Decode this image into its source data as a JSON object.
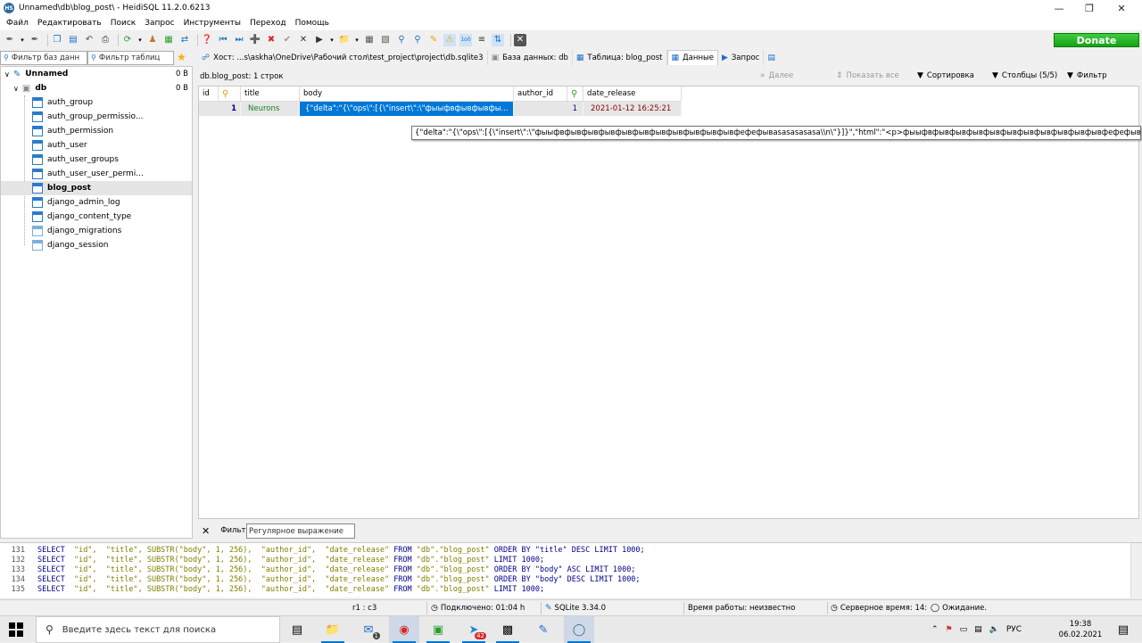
{
  "window": {
    "title": "Unnamed\\db\\blog_post\\ - HeidiSQL 11.2.0.6213",
    "app_icon": "HS"
  },
  "menu": [
    "Файл",
    "Редактировать",
    "Поиск",
    "Запрос",
    "Инструменты",
    "Переход",
    "Помощь"
  ],
  "toolbar": {
    "donate_label": "Donate"
  },
  "filters": {
    "db_filter_placeholder": "Фильтр баз данн",
    "table_filter_placeholder": "Фильтр таблиц"
  },
  "tabs": [
    {
      "label": "Хост: ...s\\askha\\OneDrive\\Рабочий стол\\test_project\\project\\db.sqlite3",
      "icon": "host-icon"
    },
    {
      "label": "База данных: db",
      "icon": "database-icon"
    },
    {
      "label": "Таблица: blog_post",
      "icon": "table-icon"
    },
    {
      "label": "Данные",
      "icon": "grid-icon",
      "active": true
    },
    {
      "label": "Запрос",
      "icon": "play-icon"
    }
  ],
  "tree": {
    "root": {
      "label": "Unnamed",
      "size": "0 B"
    },
    "db": {
      "label": "db",
      "size": "0 B"
    },
    "tables": [
      {
        "label": "auth_group"
      },
      {
        "label": "auth_group_permissio..."
      },
      {
        "label": "auth_permission"
      },
      {
        "label": "auth_user"
      },
      {
        "label": "auth_user_groups"
      },
      {
        "label": "auth_user_user_permi..."
      },
      {
        "label": "blog_post",
        "selected": true
      },
      {
        "label": "django_admin_log"
      },
      {
        "label": "django_content_type"
      },
      {
        "label": "django_migrations"
      },
      {
        "label": "django_session"
      }
    ]
  },
  "data_panel": {
    "caption": "db.blog_post: 1 строк",
    "next_label": "Далее",
    "show_all_label": "Показать все",
    "sort_label": "Сортировка",
    "columns_label": "Столбцы (5/5)",
    "filter_label": "Фильтр"
  },
  "grid": {
    "columns": [
      "id",
      "title",
      "body",
      "author_id",
      "date_release"
    ],
    "rows": [
      {
        "id": "1",
        "title": "Neurons",
        "body": "{\"delta\":\"{\\\"ops\\\":[{\\\"insert\\\":\\\"фыыфвфывфывфы...",
        "author_id": "1",
        "date_release": "2021-01-12 16:25:21"
      }
    ],
    "tooltip": "{\"delta\":\"{\\\"ops\\\":[{\\\"insert\\\":\\\"фыыфвфывфывфывфывфывфывфывфывфывфывфефефывasasasasasa\\\\n\\\"}]}\",\"html\":\"<p>фыыфвфывфывфывфывфывфывфывфывфывфывфефефывasasasasasa</p>\"}"
  },
  "filter_bar": {
    "label": "Фильт",
    "regex_placeholder": "Регулярное выражение"
  },
  "sql_log": [
    {
      "num": "131",
      "order": " ORDER BY \"title\" DESC LIMIT 1000;"
    },
    {
      "num": "132",
      "order": " LIMIT 1000;"
    },
    {
      "num": "133",
      "order": " ORDER BY \"body\" ASC LIMIT 1000;"
    },
    {
      "num": "134",
      "order": " ORDER BY \"body\" DESC LIMIT 1000;"
    },
    {
      "num": "135",
      "order": " LIMIT 1000;"
    }
  ],
  "sql_common": {
    "select": "SELECT",
    "cols": "  \"id\",  \"title\", SUBSTR(\"body\", 1, 256),  \"author_id\",  \"date_release\" ",
    "from": "FROM",
    "table": " \"db\".\"blog_post\""
  },
  "status": {
    "cursor": "r1 : c3",
    "connected": "Подключено: 01:04 h",
    "server": "SQLite 3.34.0",
    "uptime": "Время работы: неизвестно",
    "server_time": "Серверное время: 14:",
    "state": "Ожидание."
  },
  "taskbar": {
    "search_placeholder": "Введите здесь текст для поиска",
    "lang": "РУС",
    "time": "19:38",
    "date": "06.02.2021",
    "badges": {
      "mail": "1",
      "telegram": "42"
    }
  },
  "colors": {
    "selection": "#0078d7",
    "donate": "#15a315",
    "title_text": "#1a7f1a",
    "number_text": "#00008b",
    "sql_keyword": "#00008b",
    "sql_string": "#808000"
  }
}
